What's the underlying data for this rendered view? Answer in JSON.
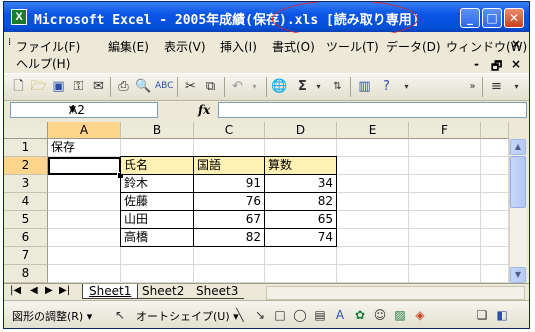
{
  "window": {
    "title": "Microsoft Excel - 2005年成績(保存).xls",
    "title_mode": "[読み取り専用]",
    "minimize": "_",
    "maximize": "□",
    "close": "✕",
    "annotation_color": "#e02424"
  },
  "menu": {
    "items": [
      "ファイル(F)",
      "編集(E)",
      "表示(V)",
      "挿入(I)",
      "書式(O)",
      "ツール(T)",
      "データ(D)",
      "ウィンドウ(W)",
      "ヘルプ(H)"
    ],
    "doc_controls": [
      "-",
      "🗗",
      "×"
    ],
    "close_x": "×"
  },
  "toolbar": {
    "icons": [
      "new-icon",
      "open-icon",
      "save-icon",
      "permission-icon",
      "email-icon",
      "print-icon",
      "print-preview-icon",
      "spelling-icon",
      "cut-icon",
      "copy-icon",
      "undo-icon",
      "hyperlink-icon",
      "autosum-icon",
      "sort-icon",
      "chart-icon",
      "help-icon"
    ],
    "sigma": "Σ",
    "overflow": "»"
  },
  "formula_bar": {
    "name_box": "A2",
    "fx": "fx",
    "formula": ""
  },
  "sheet": {
    "columns": [
      "A",
      "B",
      "C",
      "D",
      "E",
      "F"
    ],
    "rows": [
      "1",
      "2",
      "3",
      "4",
      "5",
      "6",
      "7",
      "8"
    ],
    "a1": "保存",
    "table_header": [
      "氏名",
      "国語",
      "算数"
    ],
    "table_rows": [
      [
        "鈴木",
        "91",
        "34"
      ],
      [
        "佐藤",
        "76",
        "82"
      ],
      [
        "山田",
        "67",
        "65"
      ],
      [
        "高橋",
        "82",
        "74"
      ]
    ],
    "header_fill": "#fff0b3",
    "selection_fill": "#ffd58d"
  },
  "tabs": {
    "nav": [
      "|◀",
      "◀",
      "▶",
      "▶|"
    ],
    "sheets": [
      "Sheet1",
      "Sheet2",
      "Sheet3"
    ]
  },
  "drawing": {
    "shape_adjust": "図形の調整(R) ▾",
    "autoshapes": "オートシェイプ(U) ▾"
  }
}
